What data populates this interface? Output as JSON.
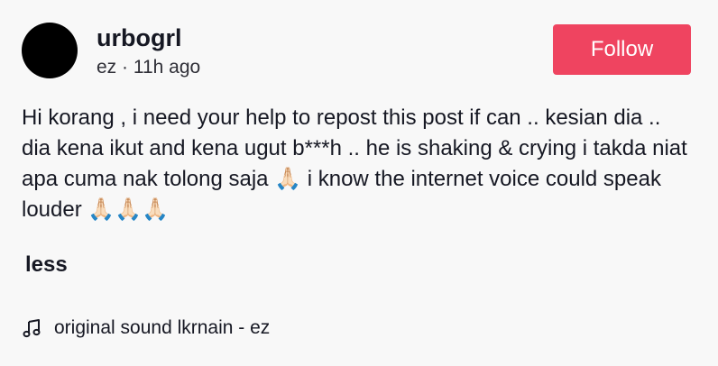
{
  "author": {
    "username": "urbogrl",
    "meta": "ez · 11h ago"
  },
  "follow_button": {
    "label": "Follow",
    "color": "#ef4460"
  },
  "post": {
    "caption": "Hi korang , i need your help to repost this post if can .. kesian dia .. dia kena ikut and kena ugut b***h .. he is shaking & crying i takda niat apa cuma nak tolong saja 🙏🏻 i know the internet voice could speak louder 🙏🏻🙏🏻🙏🏻",
    "collapse_label": "less"
  },
  "sound": {
    "icon": "music-note-icon",
    "label": "original sound lkrnain - ez"
  }
}
